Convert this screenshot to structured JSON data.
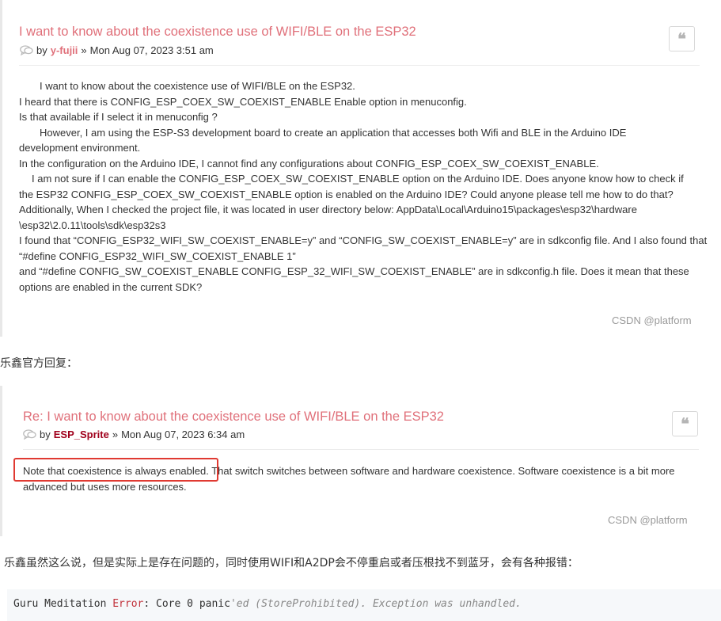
{
  "post1": {
    "title": "I want to know about the coexistence use of WIFI/BLE on the ESP32",
    "by": "by",
    "author": "y-fujii",
    "sep": "»",
    "date": "Mon Aug 07, 2023 3:51 am",
    "quote_icon": "quote-icon",
    "lines": [
      "I want to know about the coexistence use of WIFI/BLE on the ESP32.",
      "I heard that there is CONFIG_ESP_COEX_SW_COEXIST_ENABLE Enable option in menuconfig.",
      "Is that available if I select it in menuconfig ?",
      "However, I am using the ESP-S3 development board to create an application that accesses both Wifi and BLE in the Arduino IDE",
      "development environment.",
      "In the configuration on the Arduino IDE, I cannot find any configurations about CONFIG_ESP_COEX_SW_COEXIST_ENABLE.",
      "I am not sure if I can enable the CONFIG_ESP_COEX_SW_COEXIST_ENABLE option on the Arduino IDE. Does anyone know how to check if",
      "the ESP32 CONFIG_ESP_COEX_SW_COEXIST_ENABLE option is enabled on the Arduino IDE? Could anyone please tell me how to do that?",
      "Additionally, When I checked the project file, it was located in user directory below: AppData\\Local\\Arduino15\\packages\\esp32\\hardware",
      "\\esp32\\2.0.11\\tools\\sdk\\esp32s3",
      "I found that “CONFIG_ESP32_WIFI_SW_COEXIST_ENABLE=y” and “CONFIG_SW_COEXIST_ENABLE=y” are in sdkconfig file. And I also found that",
      "“#define CONFIG_ESP32_WIFI_SW_COEXIST_ENABLE 1”",
      "and “#define CONFIG_SW_COEXIST_ENABLE CONFIG_ESP_32_WIFI_SW_COEXIST_ENABLE” are in sdkconfig.h file. Does it mean that these",
      "options are enabled in the current SDK?"
    ],
    "watermark": "CSDN @platform"
  },
  "reply_intro": "乐鑫官方回复：",
  "post2": {
    "title": "Re: I want to know about the coexistence use of WIFI/BLE on the ESP32",
    "by": "by",
    "author": "ESP_Sprite",
    "sep": "»",
    "date": "Mon Aug 07, 2023 6:34 am",
    "quote_icon": "quote-icon",
    "highlight": "Note that coexistence is always enabled.",
    "rest": " That switch switches between software and hardware coexistence. Software coexistence is a bit more advanced but uses more resources.",
    "watermark": "CSDN @platform"
  },
  "comment": "乐鑫虽然这么说，但是实际上是存在问题的，同时使用WIFI和A2DP会不停重启或者压根找不到蓝牙，会有各种报错：",
  "code": {
    "part1": "Guru Meditation ",
    "part2": "Error",
    "part3": ": Core  0 panic",
    "part4": "'ed (StoreProhibited). Exception was unhandled."
  },
  "colors": {
    "title": "#e0707a",
    "author_highlight": "#a0001c",
    "highlight_box": "#e03a32"
  }
}
